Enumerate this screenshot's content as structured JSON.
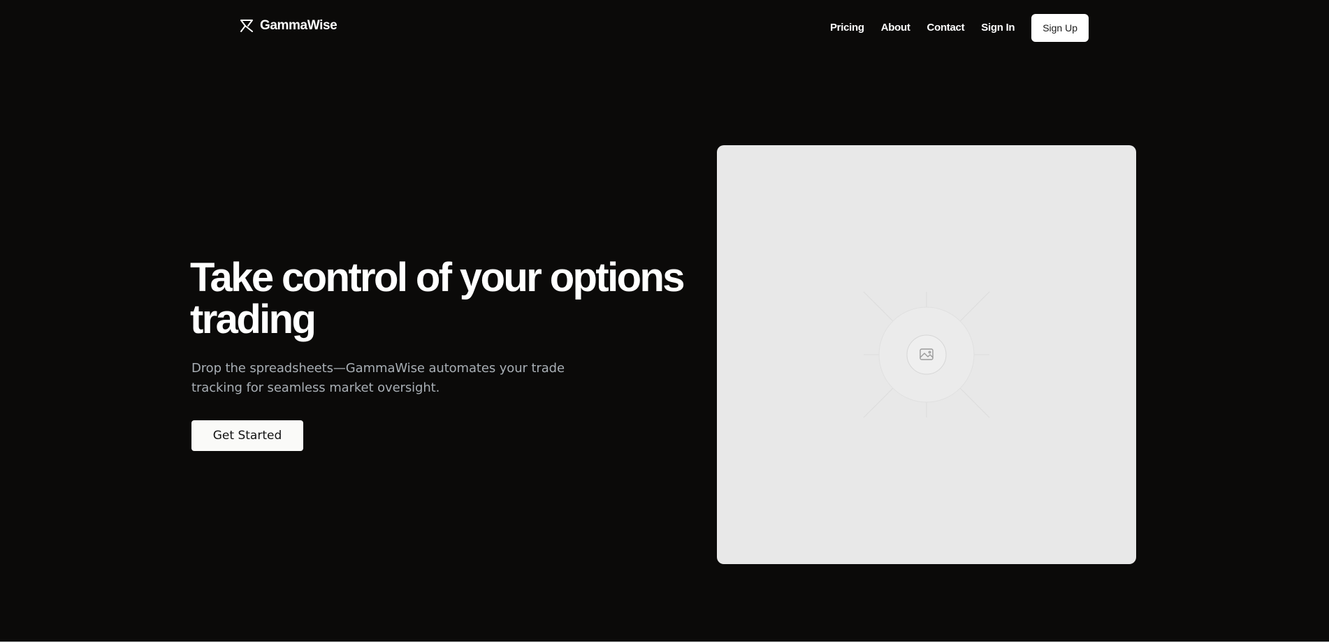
{
  "brand": {
    "name": "GammaWise",
    "logo_icon": "gammawise-logo-icon"
  },
  "nav": {
    "links": [
      {
        "label": "Pricing"
      },
      {
        "label": "About"
      },
      {
        "label": "Contact"
      },
      {
        "label": "Sign In"
      }
    ],
    "signup_label": "Sign Up"
  },
  "hero": {
    "title": "Take control of your options trading",
    "subtitle": "Drop the spreadsheets—GammaWise automates your trade tracking for seamless market oversight.",
    "cta_label": "Get Started",
    "image_icon": "image-placeholder-icon"
  },
  "colors": {
    "background": "#0b0a09",
    "text_primary": "#ffffff",
    "text_secondary": "#a8aeb4",
    "button_background": "#fafaf8",
    "placeholder_background": "#e8e8e8"
  }
}
